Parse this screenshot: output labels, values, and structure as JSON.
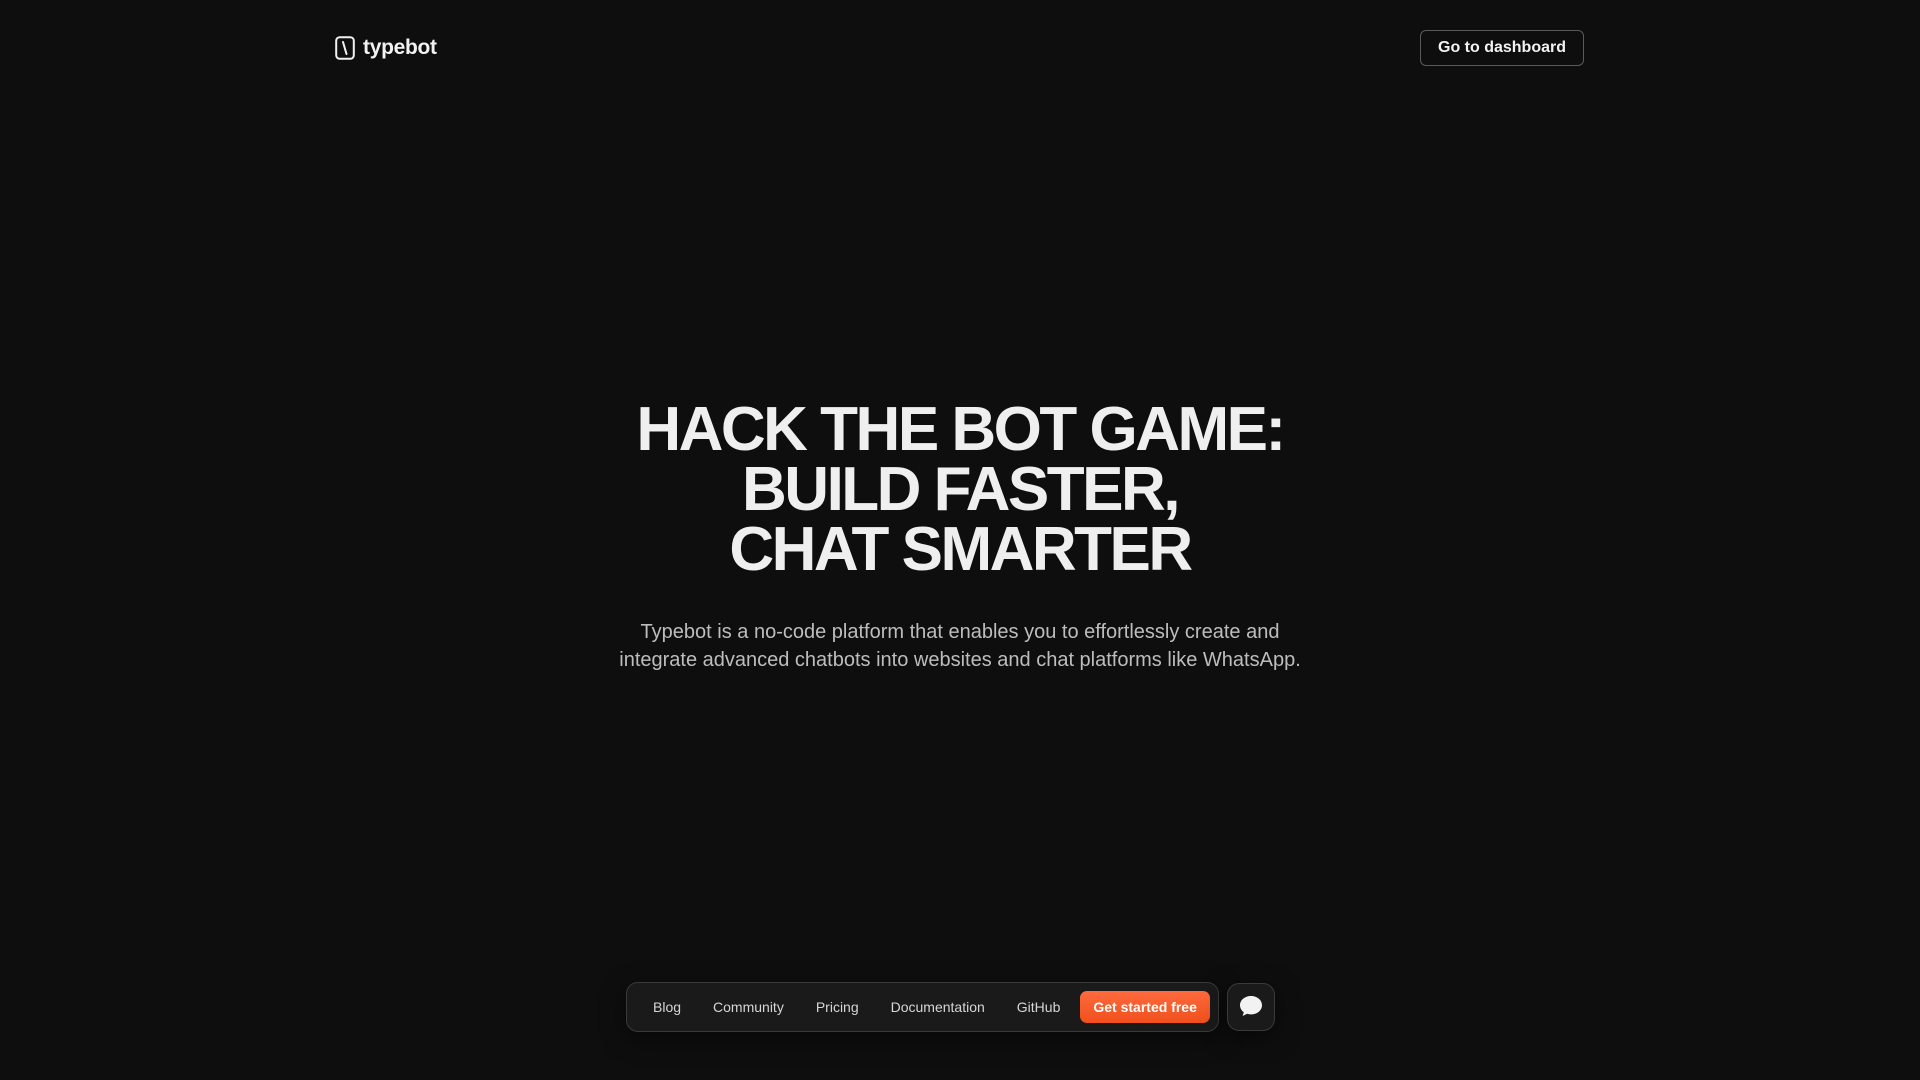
{
  "header": {
    "logo_text": "typebot",
    "dashboard_label": "Go to dashboard"
  },
  "hero": {
    "title_lines": [
      "HACK THE BOT GAME:",
      "BUILD FASTER,",
      "CHAT SMARTER"
    ],
    "subtitle_lines": [
      "Typebot is a no-code platform that enables you to effortlessly create and",
      "integrate advanced chatbots into websites and chat platforms like WhatsApp."
    ]
  },
  "bottom_nav": {
    "links": [
      {
        "label": "Blog"
      },
      {
        "label": "Community"
      },
      {
        "label": "Pricing"
      },
      {
        "label": "Documentation"
      },
      {
        "label": "GitHub"
      }
    ],
    "cta_label": "Get started free"
  },
  "icons": {
    "logo": "typebot-logo-icon",
    "chat": "chat-bubble-icon"
  },
  "colors": {
    "background": "#0e0e0e",
    "accent": "#f0501c",
    "text": "#efefef",
    "muted": "#bdbdbd"
  }
}
